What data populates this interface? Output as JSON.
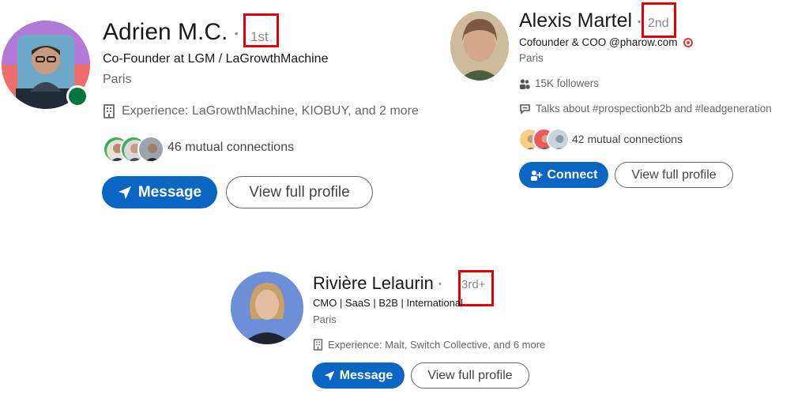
{
  "profiles": [
    {
      "name": "Adrien M.C.",
      "degree": "1st",
      "headline": "Co-Founder at LGM / LaGrowthMachine",
      "location": "Paris",
      "experience": "Experience: LaGrowthMachine, KIOBUY, and 2 more",
      "mutual": "46 mutual connections",
      "primary_button": "Message",
      "secondary_button": "View full profile",
      "online": true
    },
    {
      "name": "Alexis Martel",
      "degree": "2nd",
      "headline": "Cofounder & COO @pharow.com",
      "location": "Paris",
      "followers": "15K followers",
      "talks": "Talks about #prospectionb2b and #leadgeneration",
      "mutual": "42 mutual connections",
      "primary_button": "Connect",
      "secondary_button": "View full profile"
    },
    {
      "name": "Rivière Lelaurin",
      "degree": "3rd+",
      "headline": "CMO | SaaS | B2B | International",
      "location": "Paris",
      "experience": "Experience: Malt, Switch Collective, and 6 more",
      "primary_button": "Message",
      "secondary_button": "View full profile"
    }
  ],
  "colors": {
    "primary": "#0a66c2",
    "highlight": "#e0000a",
    "online": "#057642"
  },
  "icons": {
    "message": "paper-plane-icon",
    "connect": "add-person-icon",
    "experience": "building-icon",
    "followers": "people-icon",
    "talks": "speech-bubble-icon",
    "target": "target-emoji-icon"
  }
}
